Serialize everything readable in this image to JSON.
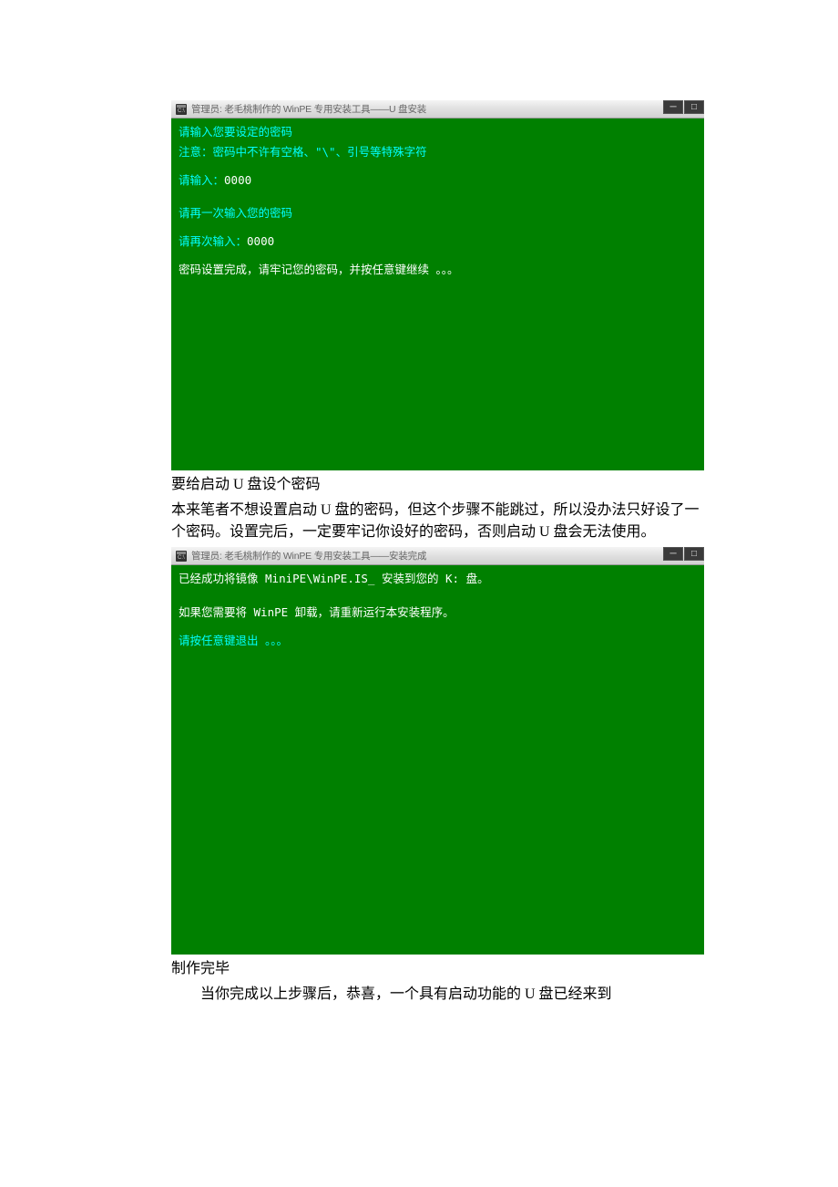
{
  "terminal1": {
    "title": "管理员: 老毛桃制作的 WinPE 专用安装工具——U 盘安装",
    "lines": {
      "l1": "请输入您要设定的密码",
      "l2": "注意：密码中不许有空格、\"\\\"、引号等特殊字符",
      "l3_prompt": "请输入：",
      "l3_value": "0000",
      "l4": "请再一次输入您的密码",
      "l5_prompt": "请再次输入：",
      "l5_value": "0000",
      "l6": "密码设置完成，请牢记您的密码，并按任意键继续 。。。"
    }
  },
  "article1": {
    "title": "要给启动 U 盘设个密码",
    "body": "本来笔者不想设置启动 U 盘的密码，但这个步骤不能跳过，所以没办法只好设了一个密码。设置完后，一定要牢记你设好的密码，否则启动 U 盘会无法使用。"
  },
  "terminal2": {
    "title": "管理员: 老毛桃制作的 WinPE 专用安装工具——安装完成",
    "lines": {
      "l1": "已经成功将镜像 MiniPE\\WinPE.IS_ 安装到您的 K: 盘。",
      "l2": "如果您需要将 WinPE 卸载，请重新运行本安装程序。",
      "l3": "请按任意键退出 。。。"
    }
  },
  "article2": {
    "title": "制作完毕",
    "body": "当你完成以上步骤后，恭喜，一个具有启动功能的 U 盘已经来到"
  }
}
